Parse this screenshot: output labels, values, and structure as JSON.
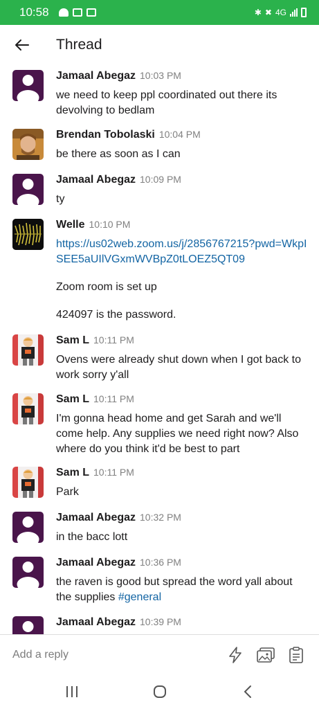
{
  "status_bar": {
    "time": "10:58",
    "network": "4G"
  },
  "header": {
    "title": "Thread"
  },
  "messages": [
    {
      "author": "Jamaal Abegaz",
      "time": "10:03 PM",
      "avatar": "default",
      "text": "we need to keep ppl coordinated out there its devolving to bedlam"
    },
    {
      "author": "Brendan Tobolaski",
      "time": "10:04 PM",
      "avatar": "photo",
      "text": "be there as soon as I can"
    },
    {
      "author": "Jamaal Abegaz",
      "time": "10:09 PM",
      "avatar": "default",
      "text": "ty"
    },
    {
      "author": "Welle",
      "time": "10:10 PM",
      "avatar": "logo",
      "link": "https://us02web.zoom.us/j/2856767215?pwd=WkpISEE5aUIlVGxmWVBpZ0tLOEZ5QT09",
      "para1": "Zoom room is set up",
      "para2": "424097 is the password."
    },
    {
      "author": "Sam L",
      "time": "10:11 PM",
      "avatar": "cartoon",
      "text": "Ovens were already shut down when I got back to work sorry y'all"
    },
    {
      "author": "Sam L",
      "time": "10:11 PM",
      "avatar": "cartoon",
      "text": "I'm gonna head home and get Sarah and we'll come help. Any supplies we need right now? Also where do you think it'd be best to part"
    },
    {
      "author": "Sam L",
      "time": "10:11 PM",
      "avatar": "cartoon",
      "text": "Park"
    },
    {
      "author": "Jamaal Abegaz",
      "time": "10:32 PM",
      "avatar": "default",
      "text": "in the bacc lott"
    },
    {
      "author": "Jamaal Abegaz",
      "time": "10:36 PM",
      "avatar": "default",
      "text": "the raven is good but spread the word yall about the supplies ",
      "channel": "#general"
    },
    {
      "author": "Jamaal Abegaz",
      "time": "10:39 PM",
      "avatar": "default",
      "text": ""
    }
  ],
  "reply": {
    "placeholder": "Add a reply"
  },
  "colors": {
    "status_bar": "#2bb24c",
    "default_avatar": "#4a154b",
    "link": "#1264a3",
    "timestamp": "#808080"
  },
  "icons": [
    "back-arrow-icon",
    "lightning-icon",
    "image-icon",
    "clipboard-icon",
    "recent-apps-icon",
    "home-icon",
    "back-nav-icon"
  ]
}
